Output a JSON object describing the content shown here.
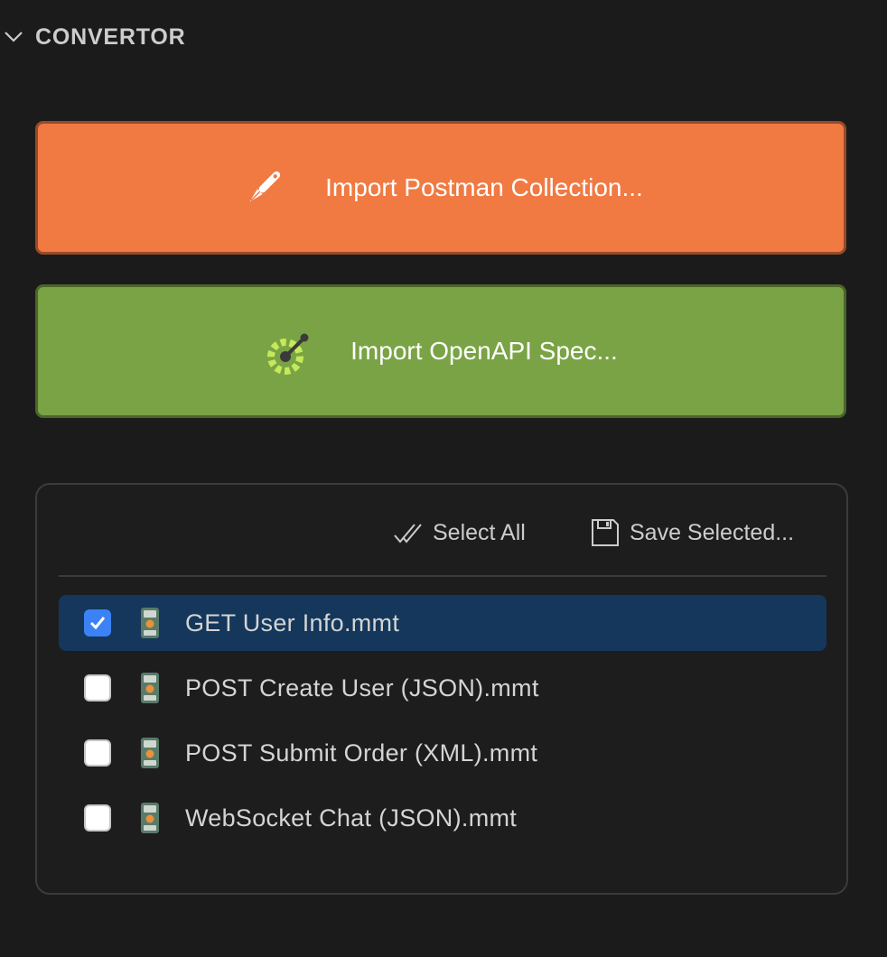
{
  "section": {
    "title": "CONVERTOR",
    "chevron_icon": "chevron-down-icon"
  },
  "buttons": {
    "postman": {
      "label": "Import Postman Collection...",
      "icon": "postman-icon",
      "color": "#f07a42"
    },
    "openapi": {
      "label": "Import OpenAPI Spec...",
      "icon": "openapi-icon",
      "color": "#7aa345"
    }
  },
  "toolbar": {
    "select_all_label": "Select All",
    "select_all_icon": "check-all-icon",
    "save_selected_label": "Save Selected...",
    "save_selected_icon": "save-icon"
  },
  "files": [
    {
      "name": "GET User Info.mmt",
      "checked": true,
      "selected": true
    },
    {
      "name": "POST Create User (JSON).mmt",
      "checked": false,
      "selected": false
    },
    {
      "name": "POST Submit Order (XML).mmt",
      "checked": false,
      "selected": false
    },
    {
      "name": "WebSocket Chat (JSON).mmt",
      "checked": false,
      "selected": false
    }
  ],
  "colors": {
    "background": "#1b1b1b",
    "selected_row": "#14375b",
    "checkbox_checked": "#3b82f6"
  }
}
